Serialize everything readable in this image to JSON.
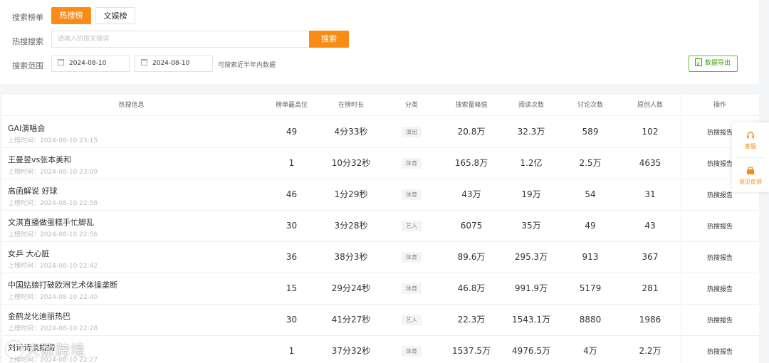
{
  "filters": {
    "list_label": "搜索榜单",
    "tabs": [
      {
        "label": "热搜榜",
        "active": true
      },
      {
        "label": "文娱榜",
        "active": false
      }
    ],
    "search_label": "热搜搜索",
    "search_placeholder": "请输入热搜关键词",
    "search_button": "搜索",
    "range_label": "搜索范围",
    "date_start": "2024-08-10",
    "date_end": "2024-08-10",
    "range_hint": "可搜索近半年内数据",
    "export_button": "数据导出"
  },
  "table": {
    "headers": [
      "热搜信息",
      "榜单最高位",
      "在榜时长",
      "分类",
      "搜索量峰值",
      "阅读次数",
      "讨论次数",
      "原创人数",
      "操作"
    ],
    "rows": [
      {
        "title": "GAI演唱会",
        "time": "上榜时间：2024-08-10 23:15",
        "rank": "49",
        "duration": "4分33秒",
        "category": "演出",
        "peak": "20.8万",
        "reads": "32.3万",
        "discussions": "589",
        "authors": "102",
        "action": "热搜报告"
      },
      {
        "title": "王曼昱vs张本美和",
        "time": "上榜时间：2024-08-10 23:09",
        "rank": "1",
        "duration": "10分32秒",
        "category": "体育",
        "peak": "165.8万",
        "reads": "1.2亿",
        "discussions": "2.5万",
        "authors": "4635",
        "action": "热搜报告"
      },
      {
        "title": "高函解说 好球",
        "time": "上榜时间：2024-08-10 22:58",
        "rank": "46",
        "duration": "1分29秒",
        "category": "体育",
        "peak": "43万",
        "reads": "19万",
        "discussions": "54",
        "authors": "31",
        "action": "热搜报告"
      },
      {
        "title": "文淇直播做蛋糕手忙脚乱",
        "time": "上榜时间：2024-08-10 22:56",
        "rank": "30",
        "duration": "3分28秒",
        "category": "艺人",
        "peak": "6075",
        "reads": "35万",
        "discussions": "49",
        "authors": "43",
        "action": "热搜报告"
      },
      {
        "title": "女乒 大心脏",
        "time": "上榜时间：2024-08-10 22:42",
        "rank": "36",
        "duration": "38分3秒",
        "category": "体育",
        "peak": "89.6万",
        "reads": "295.3万",
        "discussions": "913",
        "authors": "367",
        "action": "热搜报告"
      },
      {
        "title": "中国姑娘打破欧洲艺术体操垄断",
        "time": "上榜时间：2024-08-10 22:40",
        "rank": "15",
        "duration": "29分24秒",
        "category": "体育",
        "peak": "46.8万",
        "reads": "991.9万",
        "discussions": "5179",
        "authors": "281",
        "action": "热搜报告"
      },
      {
        "title": "金鹤龙化迪丽热巴",
        "time": "上榜时间：2024-08-10 22:28",
        "rank": "30",
        "duration": "41分27秒",
        "category": "艺人",
        "peak": "22.3万",
        "reads": "1543.1万",
        "discussions": "8880",
        "authors": "1986",
        "action": "热搜报告"
      },
      {
        "title": "刘诗诗谈婚姻",
        "time": "上榜时间：2024-08-10 22:27",
        "rank": "1",
        "duration": "37分32秒",
        "category": "体育",
        "peak": "1537.5万",
        "reads": "4976.5万",
        "discussions": "4万",
        "authors": "2.2万",
        "action": "热搜报告"
      }
    ]
  },
  "float_panel": {
    "service_label": "客服",
    "service_icon": "headset-icon",
    "feedback_label": "意见反馈",
    "feedback_icon": "feedback-icon"
  },
  "watermark": {
    "text": "大数跨境"
  },
  "colors": {
    "accent": "#fa8c16",
    "export_green": "#389e0d"
  }
}
